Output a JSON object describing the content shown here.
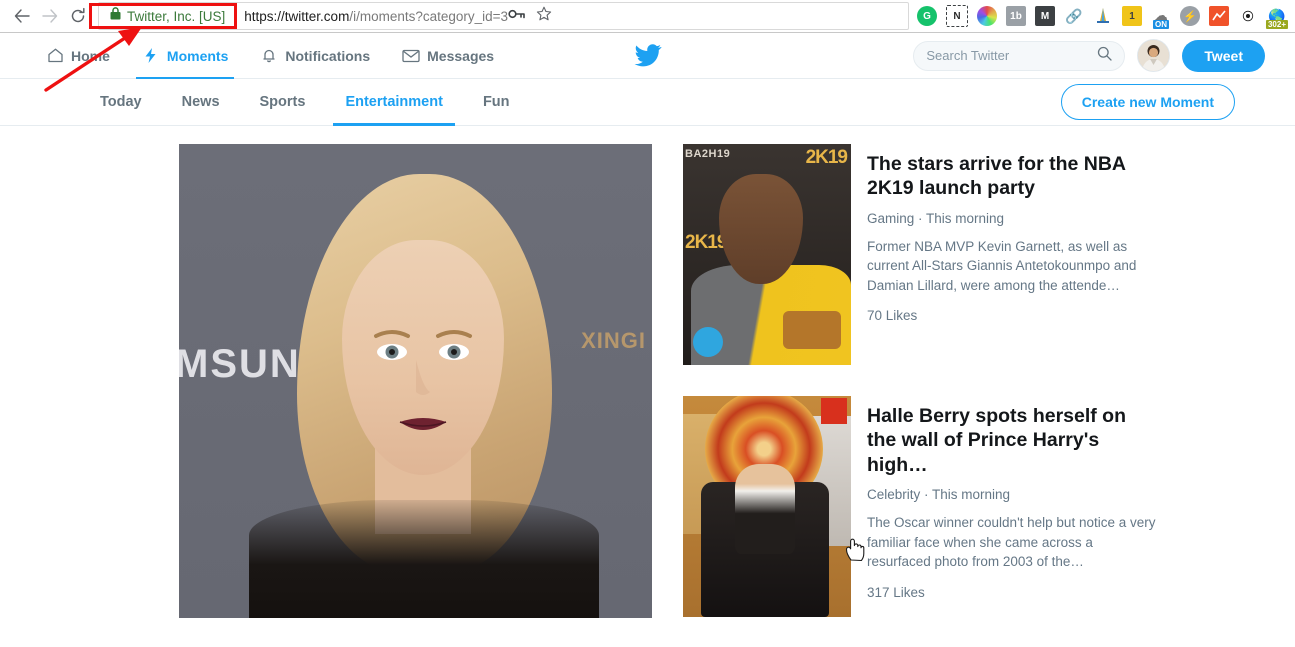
{
  "browser": {
    "back_label": "Back",
    "forward_label": "Forward",
    "reload_label": "Reload",
    "security_label": "Twitter, Inc. [US]",
    "url_scheme": "https://twitter.com",
    "url_path": "/i/moments?category_id=3",
    "url_full": "https://twitter.com/i/moments?category_id=3",
    "omnibox_actions": [
      "key-icon",
      "star-icon"
    ],
    "extensions": [
      {
        "name": "grammarly-extension-icon",
        "glyph": "G",
        "bg": "#15c26b",
        "shape": "circle",
        "color": "#ffffff"
      },
      {
        "name": "evernote-web-clipper-icon",
        "glyph": "N",
        "bg": "#ffffff",
        "shape": "dashed",
        "color": "#2dbe60"
      },
      {
        "name": "color-picker-extension-icon",
        "glyph": "",
        "bg": "#ff9933",
        "shape": "colorwheel",
        "color": "#ffffff"
      },
      {
        "name": "onebox-extension-icon",
        "glyph": "1b",
        "bg": "#9aa0a6",
        "shape": "square",
        "color": "#ffffff"
      },
      {
        "name": "mailtrack-extension-icon",
        "glyph": "M",
        "bg": "#3c4043",
        "shape": "square",
        "color": "#ffffff"
      },
      {
        "name": "link-clump-extension-icon",
        "glyph": "",
        "bg": "#4a90d9",
        "shape": "chain",
        "color": "#ffffff"
      },
      {
        "name": "analytics-tower-extension-icon",
        "glyph": "",
        "bg": "#e8b020",
        "shape": "tower",
        "color": "#ffffff"
      },
      {
        "name": "notes-tag-extension-icon",
        "glyph": "1",
        "bg": "#f0c419",
        "shape": "tag",
        "color": "#3c4043"
      },
      {
        "name": "proxy-switch-extension-icon",
        "glyph": "ON",
        "bg": "#9aa0a6",
        "shape": "badge",
        "color": "#ffffff",
        "badge": "ON",
        "badge_bg": "#1a8fe3",
        "badge_color": "#ffffff"
      },
      {
        "name": "lightning-extension-icon",
        "glyph": "⚡",
        "bg": "#9aa0a6",
        "shape": "circle",
        "color": "#ffffff"
      },
      {
        "name": "chart-extension-icon",
        "glyph": "",
        "bg": "#f0522a",
        "shape": "chart",
        "color": "#ffffff"
      },
      {
        "name": "eye-extension-icon",
        "glyph": "◉",
        "bg": "transparent",
        "shape": "eye",
        "color": "#1a1a1a"
      },
      {
        "name": "globe-counter-extension-icon",
        "glyph": "",
        "bg": "#2e9e5b",
        "shape": "globe",
        "color": "#ffffff",
        "badge": "302+",
        "badge_bg": "#9aa81f",
        "badge_color": "#ffffff"
      }
    ]
  },
  "twitter_nav": {
    "items": [
      {
        "label": "Home",
        "icon": "home-icon",
        "active": false
      },
      {
        "label": "Moments",
        "icon": "lightning-bolt-icon",
        "active": true
      },
      {
        "label": "Notifications",
        "icon": "bell-icon",
        "active": false
      },
      {
        "label": "Messages",
        "icon": "envelope-icon",
        "active": false
      }
    ],
    "logo": "twitter-bird-logo",
    "search_placeholder": "Search Twitter",
    "search_value": "",
    "tweet_label": "Tweet",
    "avatar_alt": "user-avatar"
  },
  "category_tabs": {
    "items": [
      {
        "label": "Today",
        "active": false
      },
      {
        "label": "News",
        "active": false
      },
      {
        "label": "Sports",
        "active": false
      },
      {
        "label": "Entertainment",
        "active": true
      },
      {
        "label": "Fun",
        "active": false
      }
    ],
    "create_label": "Create new Moment"
  },
  "hero": {
    "alt": "featured-moment-portrait",
    "backdrop_text_left": "MSUN",
    "backdrop_text_right": "XINGI"
  },
  "moments": [
    {
      "title": "The stars arrive for the NBA 2K19 launch party",
      "meta": "Gaming · This morning",
      "description": "Former NBA MVP Kevin Garnett, as well as current All-Stars Giannis Antetokounmpo and Damian Lillard, were among the attende…",
      "likes": "70 Likes",
      "thumb_alt": "nba-2k19-launch-party-thumbnail",
      "thumb_text_tl": "BA2H19",
      "thumb_text_tr": "2K19",
      "thumb_text_ml": "2K19"
    },
    {
      "title": "Halle Berry spots herself on the wall of Prince Harry's high…",
      "meta": "Celebrity · This morning",
      "description": "The Oscar winner couldn't help but notice a very familiar face when she came across a resurfaced photo from 2003 of the…",
      "likes": "317 Likes",
      "thumb_alt": "prince-harry-school-photo-thumbnail"
    }
  ],
  "annotations": {
    "highlight_box_label": "security-badge-highlight",
    "arrow_label": "pointer-arrow",
    "color": "#ee1111"
  },
  "colors": {
    "twitter_blue": "#1da1f2",
    "text_dark": "#14171a",
    "text_muted": "#657786",
    "nav_muted": "#66757f",
    "border": "#e6ecf0",
    "annotation_red": "#ee1111",
    "secure_green": "#3b7a3b"
  }
}
